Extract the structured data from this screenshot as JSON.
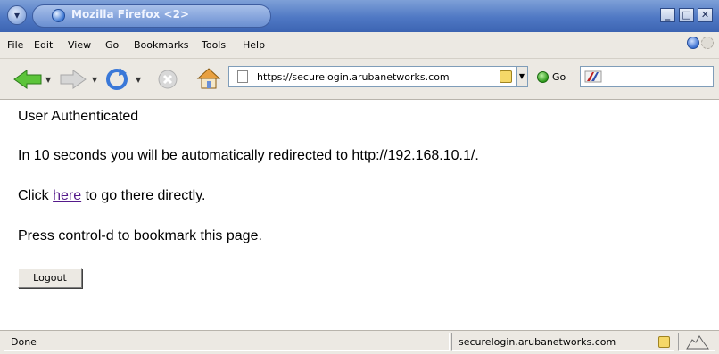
{
  "window": {
    "title": "Mozilla Firefox <2>",
    "controls": [
      "minimize",
      "maximize",
      "close"
    ]
  },
  "menu": {
    "items": [
      "File",
      "Edit",
      "View",
      "Go",
      "Bookmarks",
      "Tools",
      "Help"
    ]
  },
  "toolbar": {
    "url": "https://securelogin.arubanetworks.com",
    "go_label": "Go",
    "search_value": ""
  },
  "content": {
    "line1": "User Authenticated",
    "line2": "In 10 seconds you will be automatically redirected to http://192.168.10.1/.",
    "line3_prefix": "Click ",
    "line3_link": "here",
    "line3_suffix": " to go there directly.",
    "line4": "Press control-d to bookmark this page.",
    "logout_label": "Logout"
  },
  "status": {
    "text": "Done",
    "domain": "securelogin.arubanetworks.com"
  },
  "colors": {
    "titlebar": "#4f78c4",
    "chrome": "#ece9e3",
    "link": "#551a8b"
  },
  "icons": [
    "back-arrow-icon",
    "forward-arrow-icon",
    "reload-icon",
    "stop-icon",
    "home-icon",
    "page-icon",
    "lock-icon",
    "go-icon",
    "search-engine-icon",
    "throbber-icon"
  ]
}
